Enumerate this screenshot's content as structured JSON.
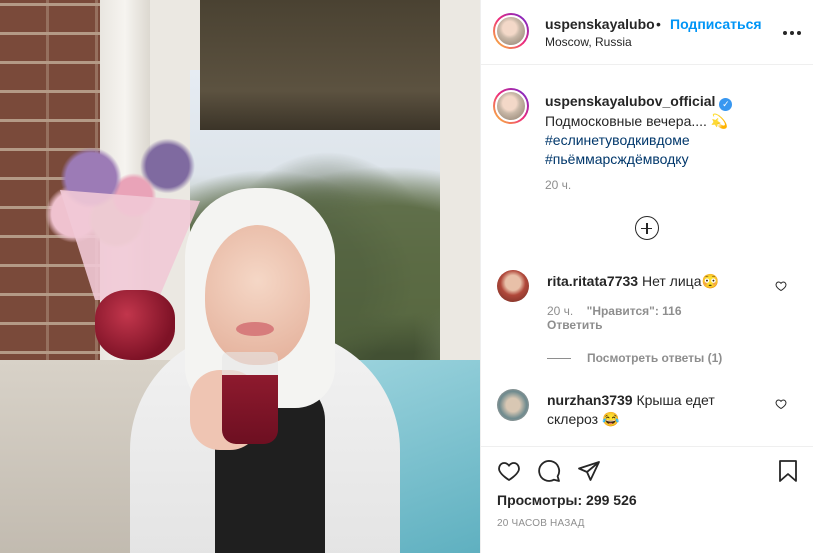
{
  "header": {
    "username": "uspenskayalubo",
    "separator": "•",
    "follow_label": "Подписаться",
    "location": "Moscow, Russia",
    "more_label": "•••"
  },
  "caption": {
    "username": "uspenskayalubov_official",
    "verified_label": "✓",
    "text": "Подмосковные вечера.... 💫",
    "hashtags": [
      "#еслинетуводкивдоме",
      "#пьёммарсждёмводку"
    ],
    "time": "20 ч."
  },
  "comments": [
    {
      "username": "rita.ritata7733",
      "text": "Нет лица😳",
      "time": "20 ч.",
      "likes_label": "\"Нравится\": 116",
      "reply_label": "Ответить",
      "view_replies": "Посмотреть ответы (1)"
    },
    {
      "username": "nurzhan3739",
      "text": "Крыша едет склероз 😂"
    }
  ],
  "actions": {
    "views_label": "Просмотры: 299 526",
    "timestamp": "20 ЧАСОВ НАЗАД"
  },
  "colors": {
    "accent": "#0095f6",
    "verified": "#3897f0",
    "muted": "#8e8e8e",
    "text": "#262626"
  },
  "icons": [
    "plus-circle-icon",
    "heart-icon",
    "comment-icon",
    "share-icon",
    "bookmark-icon",
    "more-icon",
    "verified-icon"
  ]
}
